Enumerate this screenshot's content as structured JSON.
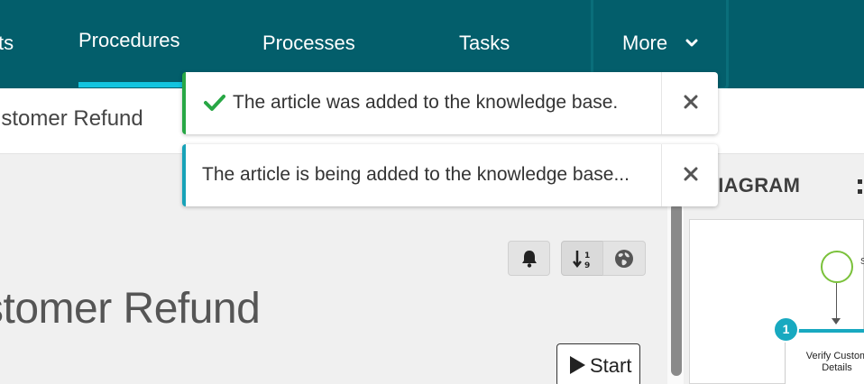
{
  "nav": {
    "items": [
      {
        "label": "ts"
      },
      {
        "label": "Procedures"
      },
      {
        "label": "Processes"
      },
      {
        "label": "Tasks"
      },
      {
        "label": "More"
      }
    ],
    "active_item": "Procedures",
    "more_icon": "chevron-down-icon"
  },
  "subheader": {
    "title": "ustomer Refund"
  },
  "main": {
    "title": "stomer Refund",
    "start_button": "Start",
    "toolbar_icons": [
      "bell-icon",
      "sort-numeric-icon",
      "globe-icon"
    ]
  },
  "diagram": {
    "tab_label": "DIAGRAM",
    "start_node_label": "S",
    "step_number": "1",
    "step_label": "Verify Custom Details"
  },
  "toasts": [
    {
      "type": "success",
      "message": "The article was added to the knowledge base.",
      "icon": "check-icon"
    },
    {
      "type": "info",
      "message": "The article is being added to the knowledge base...",
      "icon": "none"
    }
  ],
  "colors": {
    "nav_bg": "#035e6b",
    "nav_active_underline": "#13c4df",
    "success": "#28a745",
    "info": "#17a2b8",
    "step_accent": "#18a9c0",
    "start_node": "#7ac13a"
  }
}
